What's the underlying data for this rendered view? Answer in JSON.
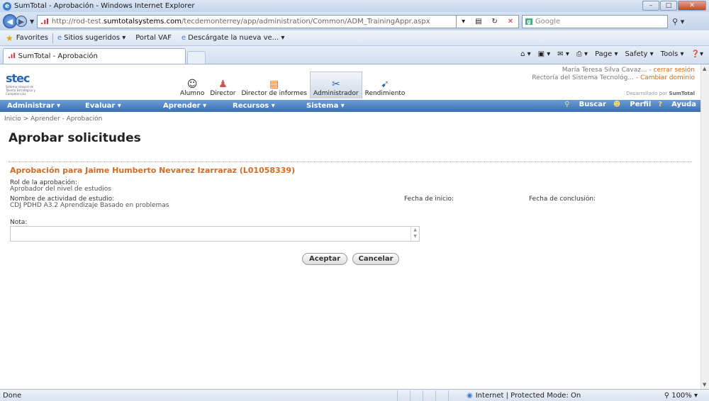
{
  "browser": {
    "window_title": "SumTotal - Aprobación - Windows Internet Explorer",
    "url_prefix": "http://rod-test.",
    "url_domain": "sumtotalsystems.com",
    "url_path": "/tecdemonterrey/app/administration/Common/ADM_TrainingAppr.aspx",
    "search_placeholder": "Google",
    "favorites_label": "Favorites",
    "fav_items": [
      "Sitios sugeridos ▾",
      "Portal VAF",
      "Descárgate la nueva ve... ▾"
    ],
    "tab_title": "SumTotal - Aprobación",
    "commands": [
      "Page ▾",
      "Safety ▾",
      "Tools ▾"
    ],
    "status_left": "Done",
    "status_zone": "Internet | Protected Mode: On",
    "status_zoom": "100%"
  },
  "site": {
    "logo_text": "stec",
    "logo_tagline": "Sistema Integral de Talento Estratégico y Competencias",
    "roles": [
      {
        "label": "Alumno",
        "icon": "student-icon"
      },
      {
        "label": "Director",
        "icon": "director-icon"
      },
      {
        "label": "Director de informes",
        "icon": "reports-icon"
      },
      {
        "label": "Administrador",
        "icon": "admin-icon"
      },
      {
        "label": "Rendimiento",
        "icon": "performance-icon"
      }
    ],
    "user_name": "María Teresa Silva Cavaz...",
    "logout": "cerrar sesión",
    "domain_name": "Rectoría del Sistema Tecnológ...",
    "change_domain": "Cambiar dominio",
    "developed_by": "Desarrollado por",
    "developer": "SumTotal",
    "menu": [
      "Administrar ▾",
      "Evaluar ▾",
      "Aprender ▾",
      "Recursos ▾",
      "Sistema ▾"
    ],
    "menu_right": [
      "Buscar",
      "Perfil",
      "Ayuda"
    ]
  },
  "page": {
    "breadcrumb": "Inicio > Aprender - Aprobación",
    "title": "Aprobar solicitudes",
    "approval_for": "Aprobación para Jaime Humberto Nevarez Izarraraz (L01058339)",
    "role_label": "Rol de la aprobación:",
    "role_value": "Aprobador del nivel de estudios",
    "activity_label": "Nombre de actividad de estudio:",
    "activity_value": "CDJ PDHD A3.2 Aprendizaje Basado en problemas",
    "start_label": "Fecha de inicio:",
    "end_label": "Fecha de conclusión:",
    "note_label": "Nota:",
    "note_value": "",
    "accept": "Aceptar",
    "cancel": "Cancelar"
  },
  "colors": {
    "accent_orange": "#d86a1f",
    "menu_blue": "#3b6fb4"
  }
}
